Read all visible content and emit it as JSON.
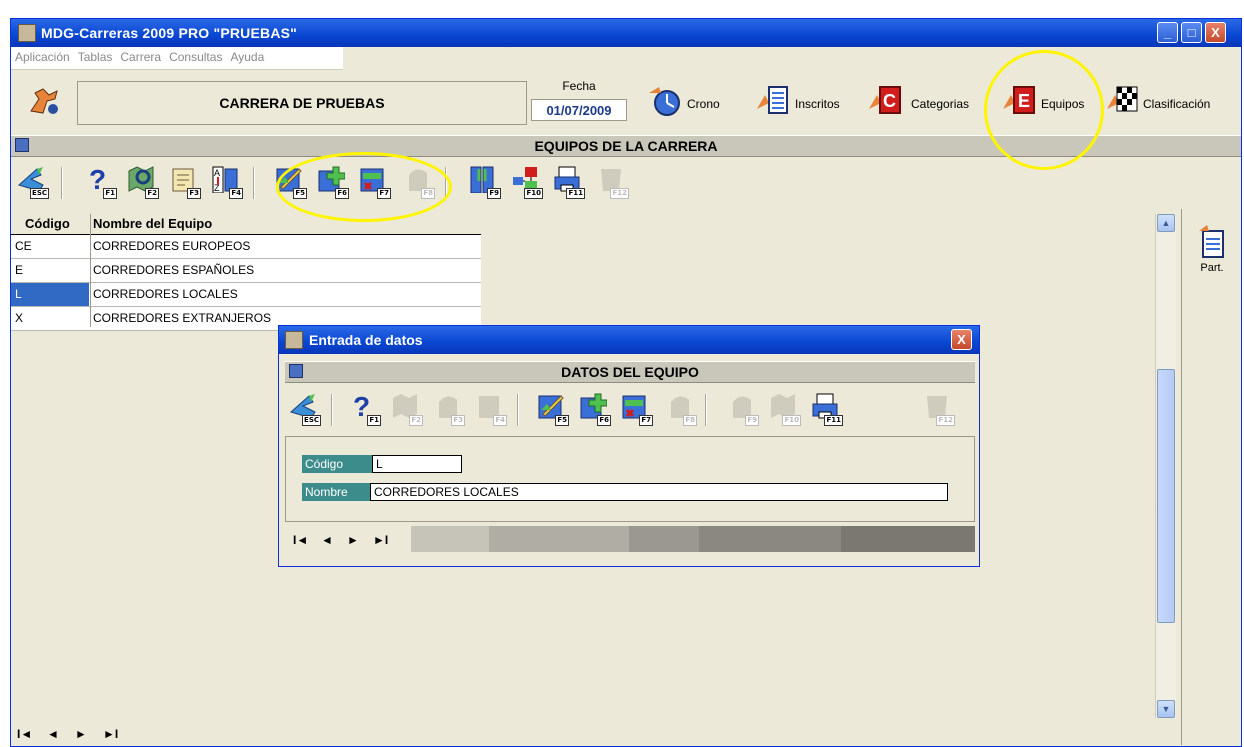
{
  "window": {
    "title": "MDG-Carreras 2009 PRO \"PRUEBAS\"",
    "controls": {
      "minimize": "_",
      "maximize": "□",
      "close": "X"
    }
  },
  "menu": [
    "Aplicación",
    "Tablas",
    "Carrera",
    "Consultas",
    "Ayuda"
  ],
  "header": {
    "race_name": "CARRERA DE PRUEBAS",
    "date_label": "Fecha",
    "date_value": "01/07/2009",
    "nav": [
      {
        "label": "Crono",
        "icon": "stopwatch-icon"
      },
      {
        "label": "Inscritos",
        "icon": "list-icon"
      },
      {
        "label": "Categorias",
        "icon": "c-icon"
      },
      {
        "label": "Equipos",
        "icon": "e-icon"
      },
      {
        "label": "Clasificación",
        "icon": "checkered-flag-icon"
      }
    ]
  },
  "section_title": "EQUIPOS DE LA CARRERA",
  "toolbar_keys": [
    "ESC",
    "F1",
    "F2",
    "F3",
    "F4",
    "F5",
    "F6",
    "F7",
    "F8",
    "F9",
    "F10",
    "F11",
    "F12"
  ],
  "grid": {
    "columns": [
      "Código",
      "Nombre del Equipo"
    ],
    "rows": [
      {
        "code": "CE",
        "name": "CORREDORES EUROPEOS"
      },
      {
        "code": "E",
        "name": "CORREDORES ESPAÑOLES"
      },
      {
        "code": "L",
        "name": "CORREDORES LOCALES"
      },
      {
        "code": "X",
        "name": "CORREDORES EXTRANJEROS"
      }
    ],
    "selected_row": 2
  },
  "side_panel": {
    "part_label": "Part."
  },
  "nav_glyphs": {
    "first": "I◄",
    "prev": "◄",
    "next": "►",
    "last": "►I"
  },
  "dialog": {
    "title": "Entrada de datos",
    "section_title": "DATOS DEL EQUIPO",
    "fields": {
      "code_label": "Código",
      "code_value": "L",
      "name_label": "Nombre",
      "name_value": "CORREDORES LOCALES"
    }
  },
  "colors": {
    "titlebar": "#0a46d2",
    "selection": "#316ac5",
    "highlight_ring": "#fff500",
    "field_label": "#3c8c8c"
  }
}
